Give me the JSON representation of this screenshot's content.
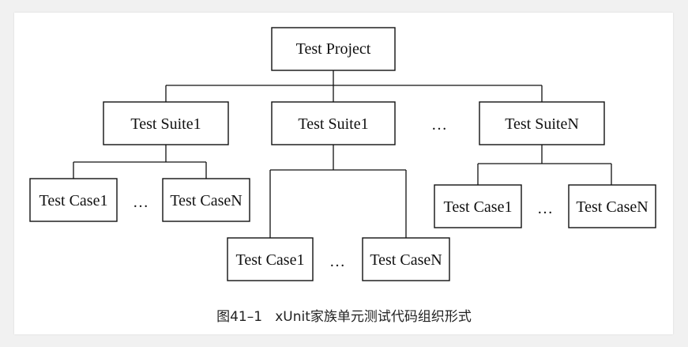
{
  "nodes": {
    "project": "Test Project",
    "suite_a": "Test Suite1",
    "suite_b": "Test Suite1",
    "suite_n": "Test SuiteN",
    "case_a1": "Test Case1",
    "case_an": "Test CaseN",
    "case_b1": "Test Case1",
    "case_bn": "Test CaseN",
    "case_n1": "Test Case1",
    "case_nn": "Test CaseN"
  },
  "ellipsis": {
    "suites": "…",
    "cases_a": "…",
    "cases_b": "…",
    "cases_n": "…"
  },
  "caption": "图41–1   xUnit家族单元测试代码组织形式",
  "colors": {
    "line": "#111111",
    "box_border": "#111111",
    "background": "#ffffff"
  }
}
